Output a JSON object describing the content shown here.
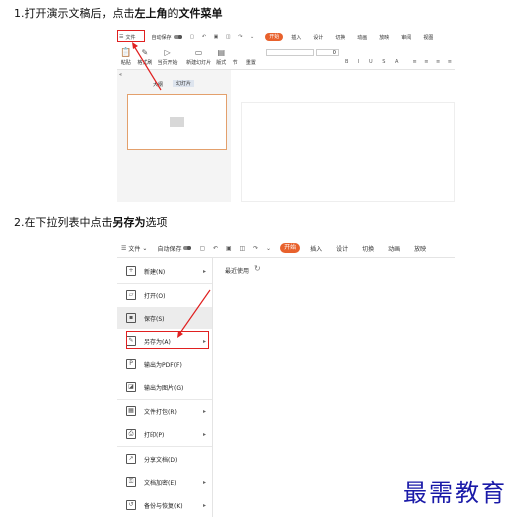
{
  "step1": {
    "text_a": "1.打开演示文稿后，点击",
    "text_b": "左上角",
    "text_c": "的",
    "text_d": "文件菜单"
  },
  "step2": {
    "text": "2.在下拉列表中点击",
    "text_b": "另存为",
    "text_c": "选项"
  },
  "shot1": {
    "menu_label": "文件",
    "autosave": "自动保存",
    "tabs": [
      "开始",
      "插入",
      "设计",
      "切换",
      "动画",
      "放映",
      "审阅",
      "视图"
    ],
    "active_tab": "开始",
    "ribbon": [
      "粘贴",
      "格式刷",
      "当页开始",
      "新建幻灯片",
      "版式",
      "节",
      "重置"
    ],
    "font_size": "0",
    "panel_tabs": [
      "大纲",
      "幻灯片"
    ],
    "colors": {
      "accent": "#e8612c",
      "highlight": "#e02020"
    }
  },
  "shot2": {
    "menu_label": "文件",
    "autosave": "自动保存",
    "tabs": [
      "开始",
      "插入",
      "设计",
      "切换",
      "动画",
      "放映"
    ],
    "recent": "最近使用",
    "items": [
      {
        "icon": "new-icon",
        "label": "新建(N)",
        "arrow": true
      },
      {
        "icon": "open-icon",
        "label": "打开(O)",
        "arrow": false
      },
      {
        "icon": "save-icon",
        "label": "保存(S)",
        "arrow": false
      },
      {
        "icon": "save-as-icon",
        "label": "另存为(A)",
        "arrow": true
      },
      {
        "icon": "pdf-icon",
        "label": "输出为PDF(F)",
        "arrow": false
      },
      {
        "icon": "image-icon",
        "label": "输出为图片(G)",
        "arrow": false
      },
      {
        "icon": "package-icon",
        "label": "文件打包(R)",
        "arrow": true
      },
      {
        "icon": "print-icon",
        "label": "打印(P)",
        "arrow": true
      },
      {
        "icon": "share-icon",
        "label": "分享文档(D)",
        "arrow": false
      },
      {
        "icon": "encrypt-icon",
        "label": "文档加密(E)",
        "arrow": true
      },
      {
        "icon": "backup-icon",
        "label": "备份与恢复(K)",
        "arrow": true
      }
    ]
  },
  "watermark": "最需教育"
}
